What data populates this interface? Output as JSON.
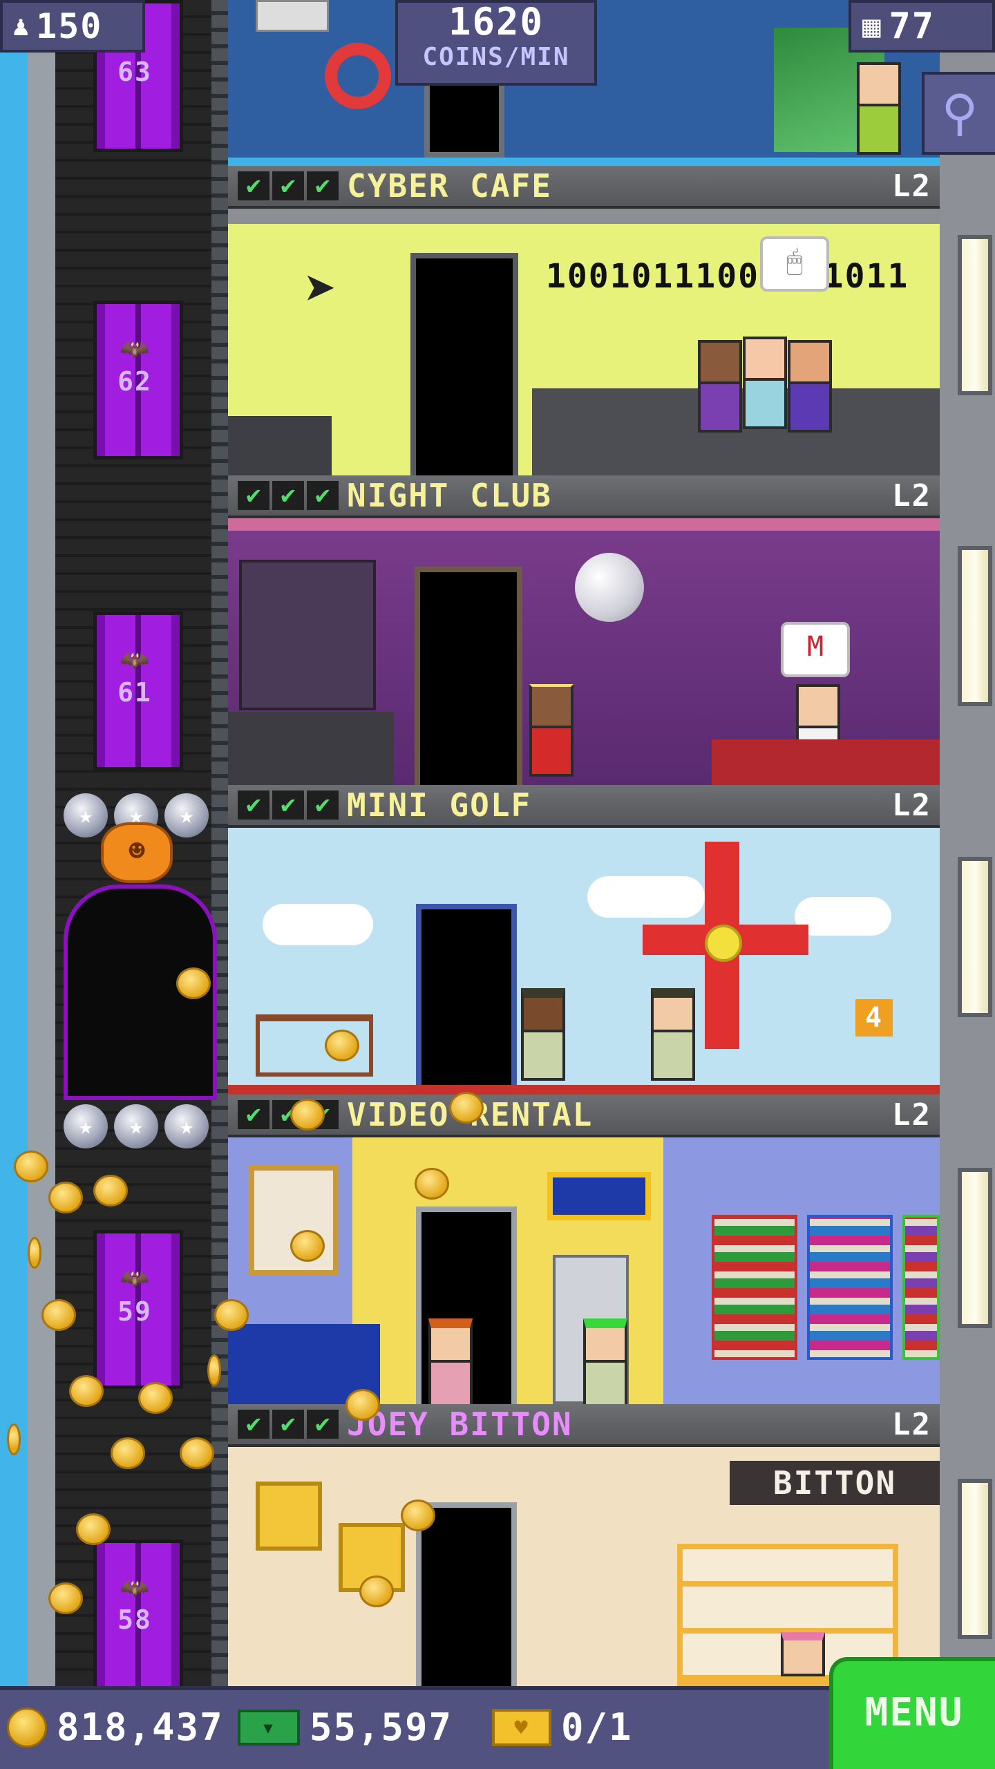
{
  "hud": {
    "population": "150",
    "population_icon": "person-icon",
    "coin_rate_value": "1620",
    "coin_rate_unit": "COINS/MIN",
    "floor_count": "77",
    "floor_icon": "building-icon",
    "search_icon": "magnifier-icon"
  },
  "elevator": {
    "floors": [
      {
        "number": "63"
      },
      {
        "number": "62"
      },
      {
        "number": "61"
      },
      {
        "number": "59"
      },
      {
        "number": "58"
      }
    ]
  },
  "rooms": [
    {
      "name": "CYBER CAFE",
      "level": "L2",
      "stocked": 3,
      "banner": "10010111001001011"
    },
    {
      "name": "NIGHT CLUB",
      "level": "L2",
      "stocked": 3
    },
    {
      "name": "MINI GOLF",
      "level": "L2",
      "stocked": 3,
      "sign": "4"
    },
    {
      "name": "VIDEO RENTAL",
      "level": "L2",
      "stocked": 3
    },
    {
      "name": "JOEY BITTON",
      "level": "L2",
      "stocked": 3,
      "sign": "BITTON"
    }
  ],
  "bottom": {
    "coins": "818,437",
    "bux": "55,597",
    "tickets": "0/1",
    "menu_label": "MENU"
  },
  "colors": {
    "hud_bg": "#4d4e7a",
    "menu_green": "#33d63a",
    "elevator_purple": "#a11ee0",
    "room_name_yellow": "#f7f19a",
    "room_name_pink": "#e98cff"
  }
}
